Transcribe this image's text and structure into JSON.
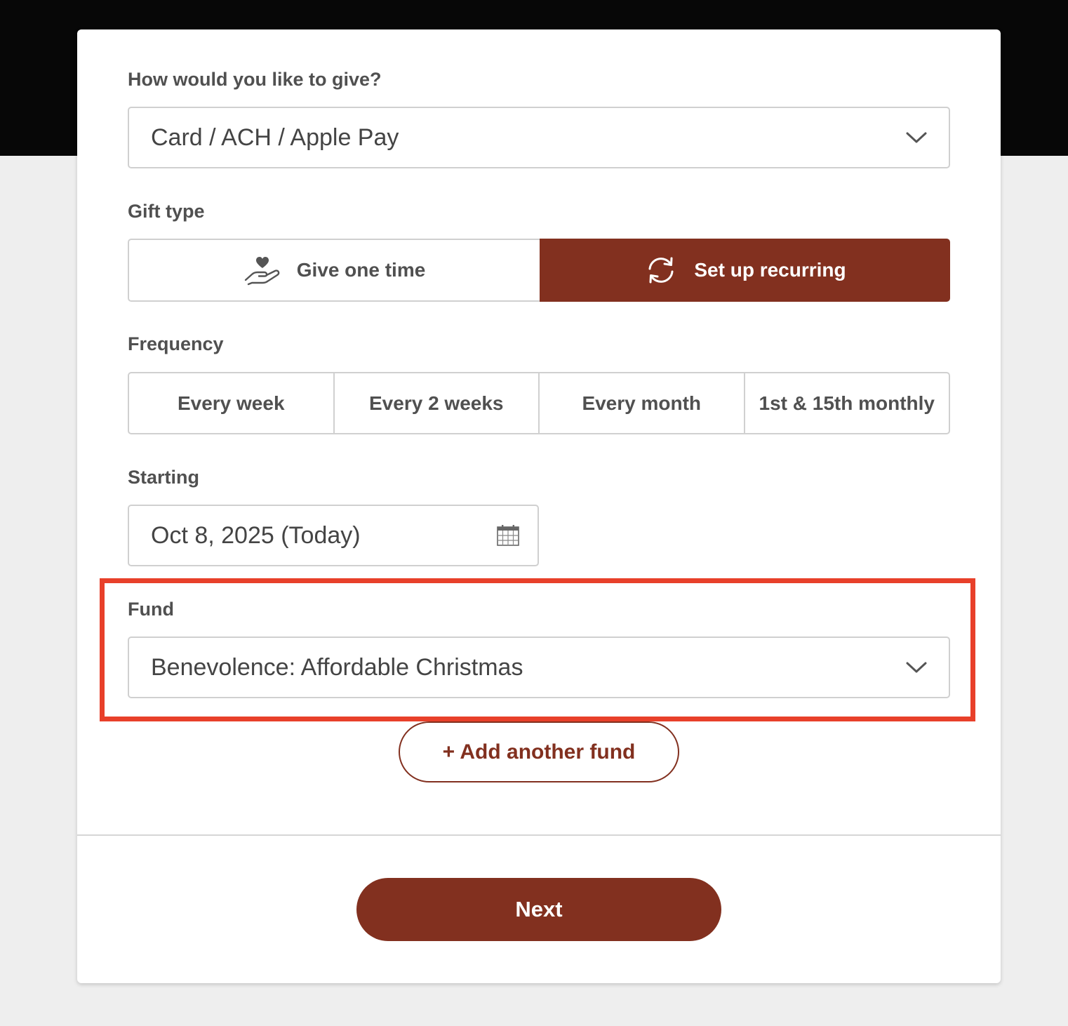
{
  "form": {
    "give_method": {
      "label": "How would you like to give?",
      "selected": "Card / ACH / Apple Pay",
      "icon": "chevron-down-icon"
    },
    "gift_type": {
      "label": "Gift type",
      "options": [
        {
          "label": "Give one time",
          "icon": "heart-hand-icon",
          "selected": false
        },
        {
          "label": "Set up recurring",
          "icon": "recurring-icon",
          "selected": true
        }
      ]
    },
    "frequency": {
      "label": "Frequency",
      "options": [
        "Every week",
        "Every 2 weeks",
        "Every month",
        "1st & 15th monthly"
      ]
    },
    "starting": {
      "label": "Starting",
      "value": "Oct 8, 2025 (Today)",
      "icon": "calendar-icon"
    },
    "fund": {
      "label": "Fund",
      "selected": "Benevolence: Affordable Christmas",
      "icon": "chevron-down-icon"
    },
    "add_fund_label": "+ Add another fund",
    "next_label": "Next"
  },
  "colors": {
    "accent": "#82301f",
    "highlight": "#e8402a",
    "header_band": "#070707",
    "page_background": "#eeeeee"
  }
}
